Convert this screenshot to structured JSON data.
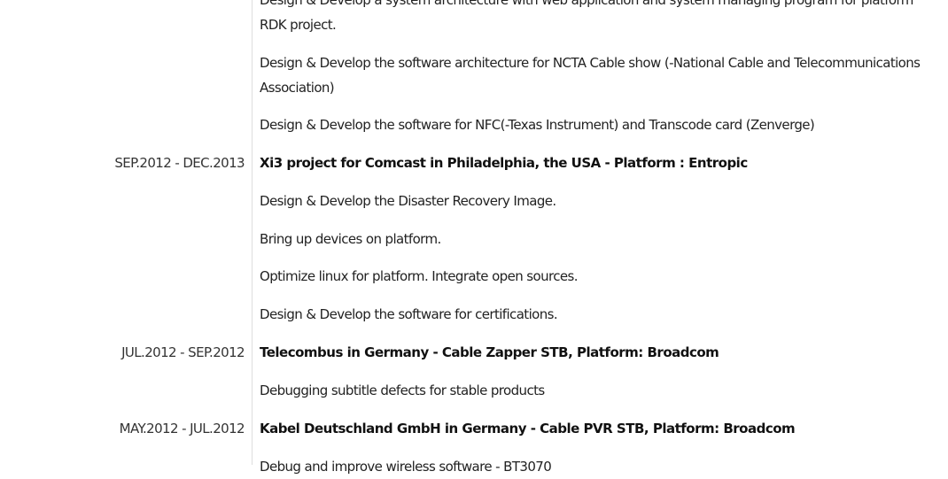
{
  "entries": {
    "d0": "Design & Develop a system architecture with web application  and system managing program for platform RDK project.",
    "d1": "Design & Develop the software architecture for NCTA Cable show (-National Cable and Telecommunications Association)",
    "d2": "Design & Develop the software for NFC(-Texas Instrument) and Transcode card (Zenverge)",
    "p1": {
      "date": "SEP.2012 - DEC.2013",
      "title": "Xi3 project for Comcast in Philadelphia, the USA - Platform : Entropic",
      "items": [
        "Design & Develop the Disaster Recovery Image.",
        "Bring up devices on platform.",
        "Optimize linux for platform. Integrate  open sources.",
        "Design & Develop the software for certifications."
      ]
    },
    "p2": {
      "date": "JUL.2012 - SEP.2012",
      "title": "Telecombus in Germany - Cable Zapper STB, Platform: Broadcom",
      "items": [
        "Debugging subtitle defects for stable products"
      ]
    },
    "p3": {
      "date": "MAY.2012 - JUL.2012",
      "title": "Kabel Deutschland GmbH in Germany - Cable PVR STB, Platform: Broadcom",
      "items": [
        "Debug and improve wireless software - BT3070"
      ]
    }
  }
}
